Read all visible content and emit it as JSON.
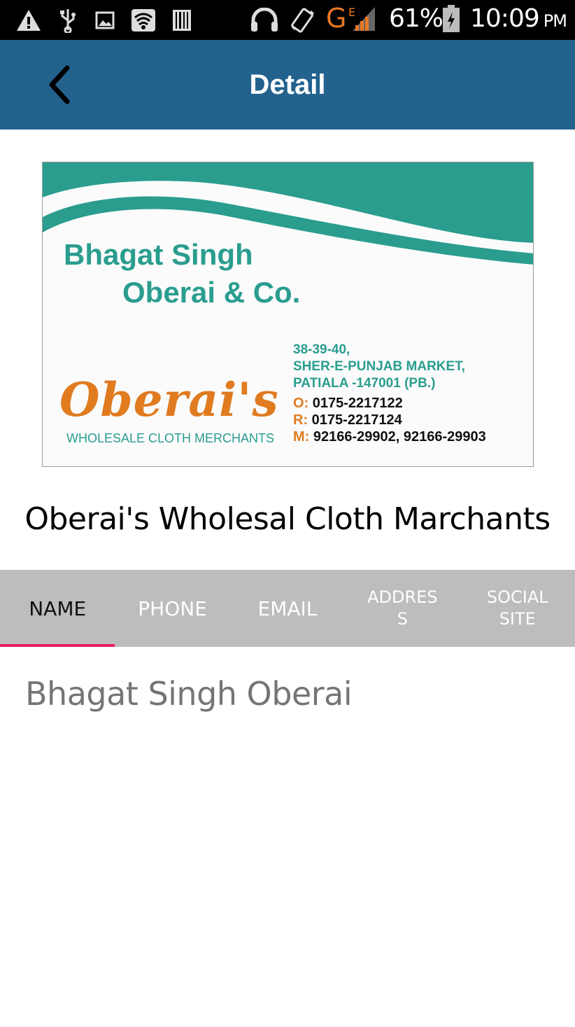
{
  "status_bar": {
    "icons": [
      "warning-icon",
      "usb-icon",
      "image-icon",
      "wifi-icon",
      "barcode-icon",
      "headset-icon",
      "vibrate-icon",
      "signal-icon",
      "battery-icon"
    ],
    "network_type": "G",
    "network_sub": "E",
    "battery_percent": "61%",
    "time": "10:09",
    "ampm": "PM"
  },
  "app_bar": {
    "title": "Detail",
    "back_icon": "chevron-left-icon"
  },
  "card": {
    "line1": "Bhagat Singh",
    "line2": "Oberai & Co.",
    "brand": "Oberai's",
    "tagline": "WHOLESALE CLOTH MERCHANTS",
    "address_lines": [
      "38-39-40,",
      "SHER-E-PUNJAB MARKET,",
      "PATIALA -147001 (PB.)"
    ],
    "contacts": [
      {
        "label": "O:",
        "value": "0175-2217122"
      },
      {
        "label": "R:",
        "value": "0175-2217124"
      },
      {
        "label": "M:",
        "value": "92166-29902, 92166-29903"
      }
    ],
    "colors": {
      "teal": "#2a9d8f",
      "orange": "#e07b1f"
    }
  },
  "business_title": "Oberai's Wholesal Cloth Marchants",
  "tabs": [
    {
      "label": "NAME",
      "active": true
    },
    {
      "label": "PHONE",
      "active": false
    },
    {
      "label": "EMAIL",
      "active": false
    },
    {
      "label": "ADDRES\nS",
      "active": false
    },
    {
      "label": "SOCIAL\nSITE",
      "active": false
    }
  ],
  "content": {
    "value": "Bhagat Singh Oberai"
  },
  "colors": {
    "app_bar": "#24628e",
    "tab_bar": "#bdbdbd",
    "tab_indicator": "#e91e63"
  }
}
